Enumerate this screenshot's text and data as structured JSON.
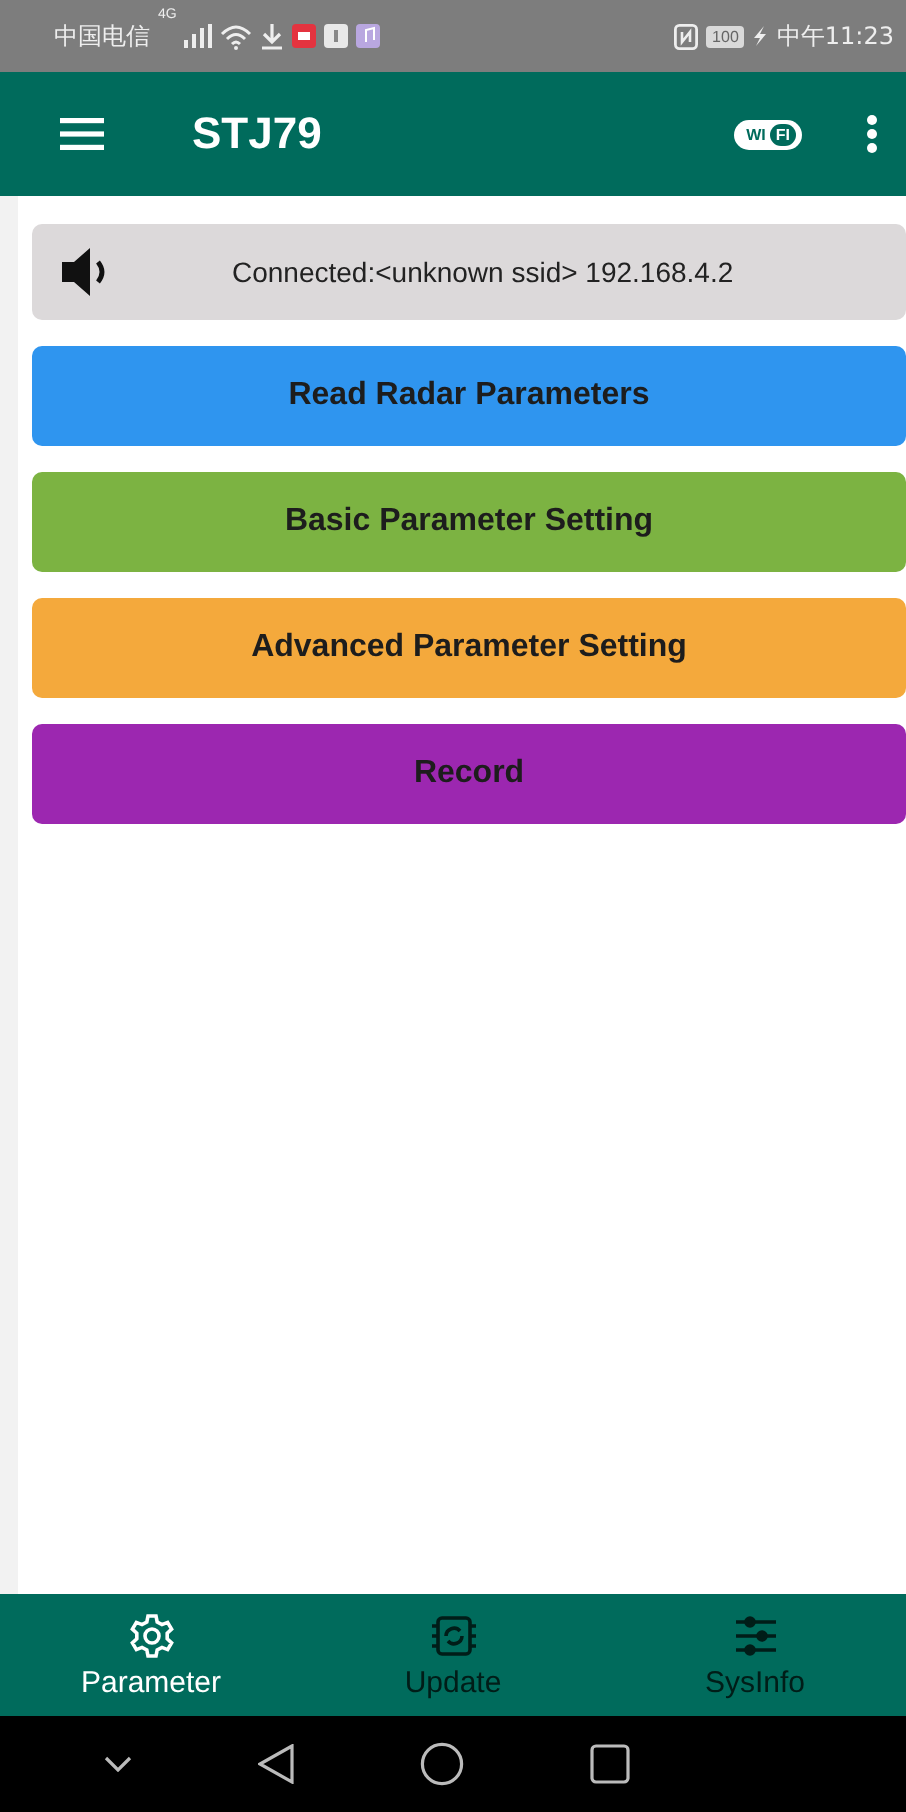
{
  "status_bar": {
    "carrier": "中国电信",
    "network": "4G",
    "battery": "100",
    "time": "中午11:23"
  },
  "app_bar": {
    "title": "STJ79",
    "wifi_badge": [
      "WI",
      "FI"
    ]
  },
  "connection": {
    "text": "Connected:<unknown ssid> 192.168.4.2"
  },
  "actions": [
    {
      "label": "Read Radar Parameters",
      "color": "#2f95ef"
    },
    {
      "label": "Basic Parameter Setting",
      "color": "#7cb342"
    },
    {
      "label": "Advanced Parameter Setting",
      "color": "#f4a93c"
    },
    {
      "label": "Record",
      "color": "#9c27b0"
    }
  ],
  "bottom_nav": [
    {
      "label": "Parameter",
      "kind": "gear",
      "selected": true
    },
    {
      "label": "Update",
      "kind": "chip",
      "selected": false
    },
    {
      "label": "SysInfo",
      "kind": "sliders",
      "selected": false
    }
  ]
}
